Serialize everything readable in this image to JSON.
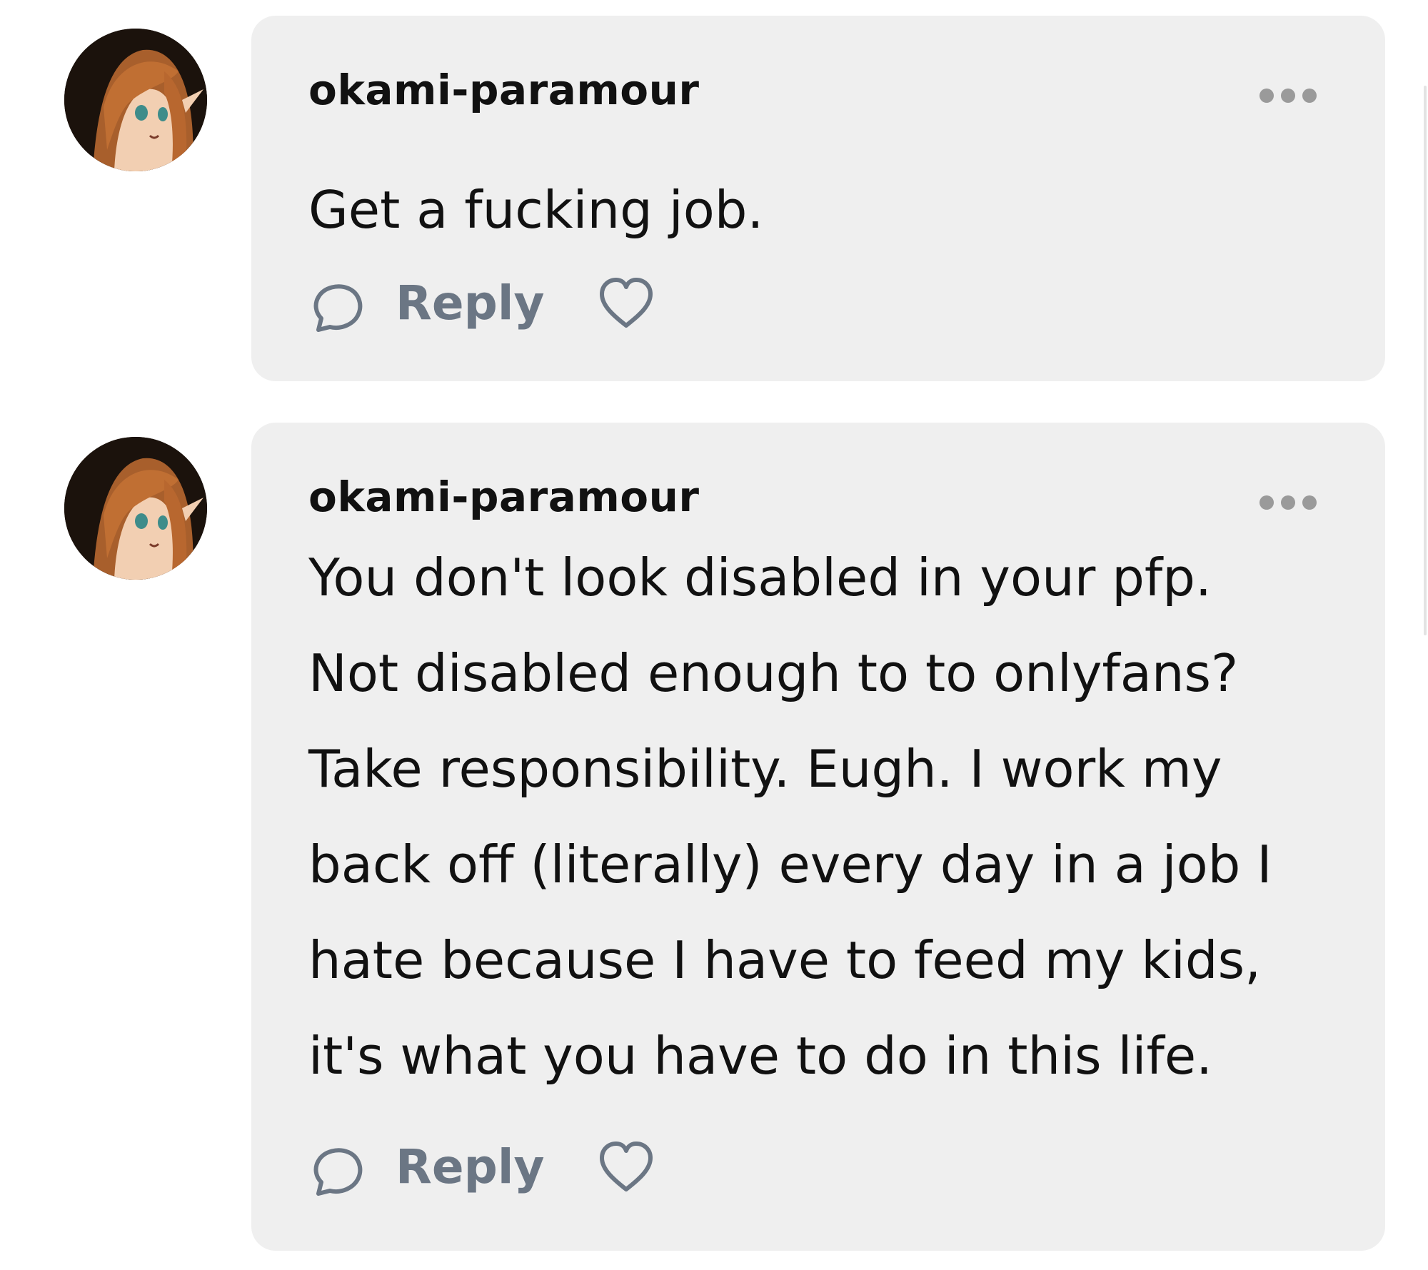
{
  "comments": [
    {
      "username": "okami-paramour",
      "avatar_icon": "anime-avatar",
      "body_lines": [
        "Get a fucking job."
      ],
      "reply_label": "Reply",
      "reply_icon": "speech-bubble-icon",
      "like_icon": "heart-icon",
      "more_icon": "more-dots-icon"
    },
    {
      "username": "okami-paramour",
      "avatar_icon": "anime-avatar",
      "body_lines": [
        "You don't look disabled in your pfp.",
        "Not disabled enough to to onlyfans?",
        "Take responsibility. Eugh. I work my",
        "back off (literally) every day in a job I",
        "hate because I have to feed my kids,",
        "it's what you have to do in this life."
      ],
      "reply_label": "Reply",
      "reply_icon": "speech-bubble-icon",
      "like_icon": "heart-icon",
      "more_icon": "more-dots-icon"
    }
  ],
  "colors": {
    "bubble_bg": "#efefef",
    "text": "#111111",
    "action_gray": "#6b7684",
    "dots_gray": "#9a9a9a"
  }
}
